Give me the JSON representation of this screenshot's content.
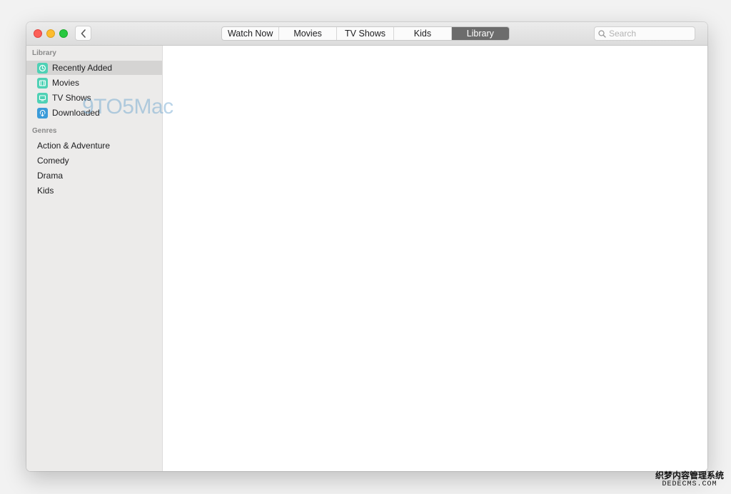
{
  "window": {
    "tabs": [
      {
        "label": "Watch Now"
      },
      {
        "label": "Movies"
      },
      {
        "label": "TV Shows"
      },
      {
        "label": "Kids"
      },
      {
        "label": "Library",
        "active": true
      }
    ],
    "search": {
      "placeholder": "Search"
    }
  },
  "sidebar": {
    "library_header": "Library",
    "library_items": [
      {
        "label": "Recently Added",
        "icon": "clock-icon",
        "selected": true
      },
      {
        "label": "Movies",
        "icon": "film-icon"
      },
      {
        "label": "TV Shows",
        "icon": "tv-icon"
      },
      {
        "label": "Downloaded",
        "icon": "download-icon"
      }
    ],
    "genres_header": "Genres",
    "genres": [
      "Action & Adventure",
      "Comedy",
      "Drama",
      "Kids"
    ]
  },
  "watermark": {
    "text": "9TO5Mac"
  },
  "corner_watermark": {
    "line1": "织梦内容管理系统",
    "line2": "DEDECMS.COM"
  },
  "colors": {
    "accent_teal": "#4fd1b5",
    "accent_blue": "#3b9bd9",
    "active_tab": "#6c6c6c",
    "sidebar_bg": "#ecebea"
  }
}
